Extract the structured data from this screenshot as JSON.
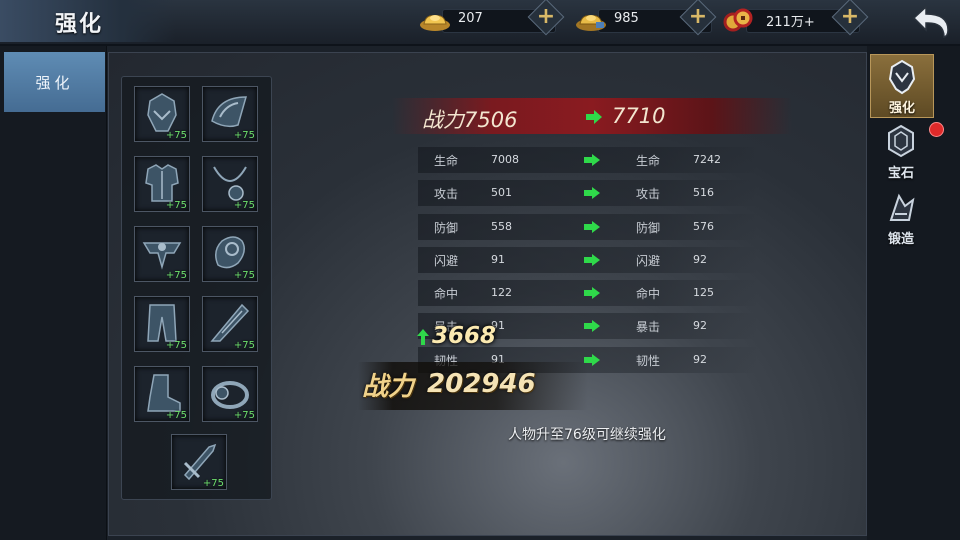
{
  "header": {
    "title": "强化"
  },
  "currencies": [
    {
      "name": "gold-ingot",
      "value": "207"
    },
    {
      "name": "silver-ingot",
      "value": "985"
    },
    {
      "name": "copper-coins",
      "value": "211万+"
    }
  ],
  "left_tabs": [
    {
      "label": "强化",
      "active": true
    }
  ],
  "equipment_slots": [
    {
      "icon": "helmet-icon",
      "level": "+75"
    },
    {
      "icon": "shoulder-icon",
      "level": "+75"
    },
    {
      "icon": "armor-icon",
      "level": "+75"
    },
    {
      "icon": "necklace-icon",
      "level": "+75"
    },
    {
      "icon": "belt-icon",
      "level": "+75"
    },
    {
      "icon": "bracer-icon",
      "level": "+75"
    },
    {
      "icon": "pants-icon",
      "level": "+75"
    },
    {
      "icon": "blade-icon",
      "level": "+75"
    },
    {
      "icon": "boots-icon",
      "level": "+75"
    },
    {
      "icon": "ring-icon",
      "level": "+75"
    },
    {
      "icon": "sword-icon",
      "level": "+75"
    }
  ],
  "combat_power": {
    "label": "战力",
    "old": "7506",
    "new": "7710"
  },
  "stats": [
    {
      "name": "生命",
      "old": "7008",
      "new": "7242"
    },
    {
      "name": "攻击",
      "old": "501",
      "new": "516"
    },
    {
      "name": "防御",
      "old": "558",
      "new": "576"
    },
    {
      "name": "闪避",
      "old": "91",
      "new": "92"
    },
    {
      "name": "命中",
      "old": "122",
      "new": "125"
    },
    {
      "name": "暴击",
      "old": "91",
      "new": "92"
    },
    {
      "name": "韧性",
      "old": "91",
      "new": "92"
    }
  ],
  "power_gain": "3668",
  "total_power": {
    "label": "战力",
    "value": "202946"
  },
  "notice": "人物升至76级可继续强化",
  "right_tabs": [
    {
      "label": "强化",
      "icon": "enhance-icon",
      "active": true
    },
    {
      "label": "宝石",
      "icon": "gem-icon",
      "badge": true
    },
    {
      "label": "锻造",
      "icon": "forge-icon"
    }
  ],
  "colors": {
    "accent_gold": "#d8b867",
    "arrow_green": "#2fd94a",
    "banner_red": "#8a1b20",
    "tab_blue": "#5f8cb4"
  }
}
